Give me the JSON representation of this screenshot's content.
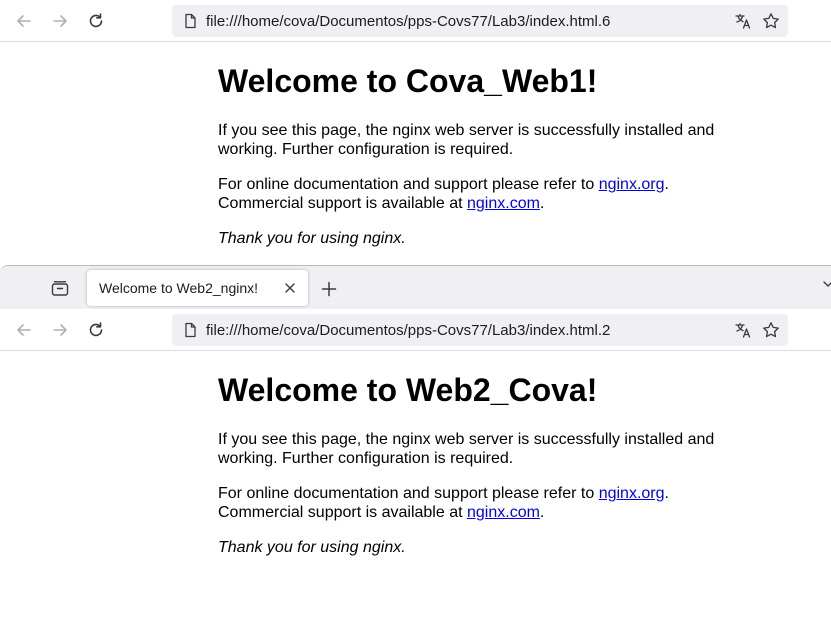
{
  "window1": {
    "url": "file:///home/cova/Documentos/pps-Covs77/Lab3/index.html.6",
    "heading": "Welcome to Cova_Web1!",
    "para1": "If you see this page, the nginx web server is successfully installed and working. Further configuration is required.",
    "para2_prefix": "For online documentation and support please refer to ",
    "para2_link1": "nginx.org",
    "para2_middle": ".",
    "para2_line2_prefix": "Commercial support is available at ",
    "para2_link2": "nginx.com",
    "para2_suffix": ".",
    "thanks": "Thank you for using nginx."
  },
  "window2": {
    "tab_title": "Welcome to Web2_nginx!",
    "url": "file:///home/cova/Documentos/pps-Covs77/Lab3/index.html.2",
    "heading": "Welcome to Web2_Cova!",
    "para1": "If you see this page, the nginx web server is successfully installed and working. Further configuration is required.",
    "para2_prefix": "For online documentation and support please refer to ",
    "para2_link1": "nginx.org",
    "para2_middle": ".",
    "para2_line2_prefix": "Commercial support is available at ",
    "para2_link2": "nginx.com",
    "para2_suffix": ".",
    "thanks": "Thank you for using nginx."
  },
  "icons": {
    "back": "arrow-left-icon",
    "forward": "arrow-right-icon",
    "reload": "reload-icon",
    "page": "page-icon",
    "translate": "translate-icon",
    "bookmark": "star-icon",
    "tab_list": "tab-list-icon",
    "new_tab": "plus-icon",
    "close": "close-icon"
  },
  "colors": {
    "link": "#0000ee",
    "urlbar_bg": "#f0f0f4",
    "tabstrip_bg": "#f0f0f4"
  }
}
